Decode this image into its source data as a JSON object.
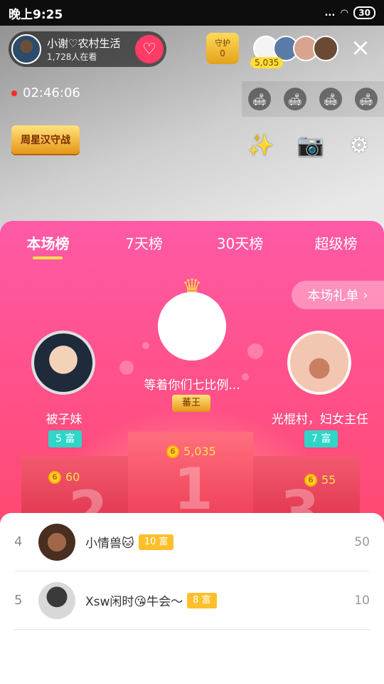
{
  "status_bar": {
    "time": "晚上9:25",
    "signal": "...",
    "battery": "30"
  },
  "host": {
    "name": "小谢♡农村生活",
    "viewers": "1,728人在看"
  },
  "guard": {
    "label": "守护",
    "count": "0"
  },
  "top_viewers": {
    "count": "5,035"
  },
  "stream": {
    "elapsed": "02:46:06"
  },
  "weekly_badge": {
    "label": "周星汉守战"
  },
  "tabs": [
    "本场榜",
    "7天榜",
    "30天榜",
    "超级榜"
  ],
  "gift_list": {
    "label": "本场礼单"
  },
  "podium": {
    "first": {
      "name": "等着你们七比例...",
      "badge": "蕃王",
      "amount": "5,035",
      "number": "1"
    },
    "second": {
      "name": "被子妹",
      "level": "5 富",
      "amount": "60",
      "number": "2"
    },
    "third": {
      "name": "光棍村，妇女主任",
      "level": "7 富",
      "amount": "55",
      "number": "3"
    }
  },
  "list": [
    {
      "rank": "4",
      "name": "小情兽🐱",
      "level": "10 富",
      "score": "50"
    },
    {
      "rank": "5",
      "name": "Xsw闲时😘牛会～",
      "level": "8 富",
      "score": "10"
    }
  ],
  "colors": {
    "panel_top": "#ff5aa6",
    "panel_bottom": "#ff4159",
    "accent_yellow": "#ffe04c",
    "teal": "#2fd5c9"
  }
}
